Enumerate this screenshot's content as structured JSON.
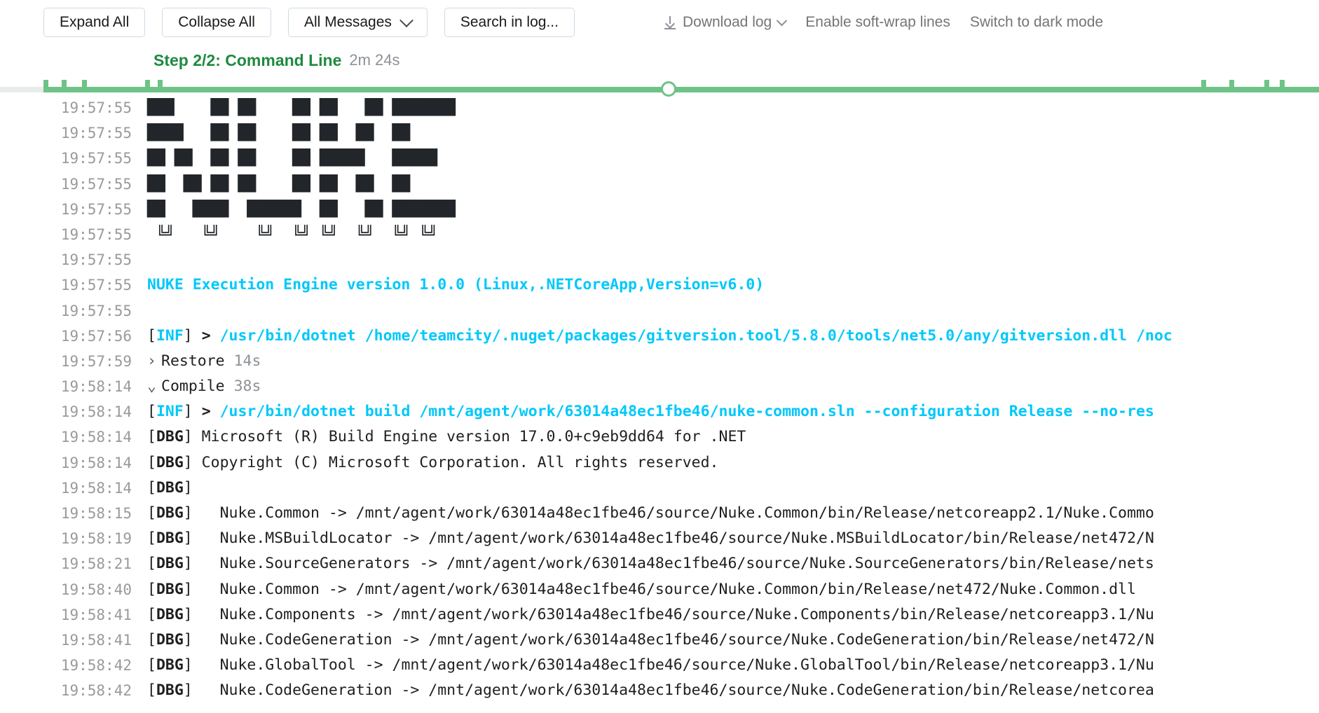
{
  "toolbar": {
    "expand_all": "Expand All",
    "collapse_all": "Collapse All",
    "filter_label": "All Messages",
    "search_label": "Search in log...",
    "download_log": "Download log",
    "soft_wrap": "Enable soft-wrap lines",
    "dark_mode": "Switch to dark mode",
    "download_icon": "download-icon",
    "chevron_icon": "chevron-down-icon"
  },
  "step": {
    "title": "Step 2/2: Command Line",
    "duration": "2m 24s",
    "progress_percent": 49,
    "accent_color": "#1f8a3f",
    "bar_color": "#6ec387",
    "track_color": "#e8eaec"
  },
  "log": {
    "lines": [
      {
        "ts": "19:57:55",
        "type": "art",
        "text": "███    ██ ██    ██ ██   ██ ███████"
      },
      {
        "ts": "19:57:55",
        "type": "art",
        "text": "████   ██ ██    ██ ██  ██  ██"
      },
      {
        "ts": "19:57:55",
        "type": "art",
        "text": "██ ██  ██ ██    ██ █████   █████"
      },
      {
        "ts": "19:57:55",
        "type": "art",
        "text": "██  ██ ██ ██    ██ ██  ██  ██"
      },
      {
        "ts": "19:57:55",
        "type": "art",
        "text": "██   ████  ██████  ██   ██ ███████"
      },
      {
        "ts": "19:57:55",
        "type": "art",
        "text": " ╚╝   ╚╝    ╚╝  ╚╝ ╚╝  ╚╝  ╚╝ ╚╝"
      },
      {
        "ts": "19:57:55",
        "type": "blank",
        "text": ""
      },
      {
        "ts": "19:57:55",
        "type": "cyan",
        "text": "NUKE Execution Engine version 1.0.0 (Linux,.NETCoreApp,Version=v6.0)"
      },
      {
        "ts": "19:57:55",
        "type": "blank",
        "text": ""
      },
      {
        "ts": "19:57:56",
        "type": "inf-cmd",
        "level": "INF",
        "arrow": ">",
        "text": "/usr/bin/dotnet /home/teamcity/.nuget/packages/gitversion.tool/5.8.0/tools/net5.0/any/gitversion.dll /noc"
      },
      {
        "ts": "19:57:59",
        "type": "block",
        "fold": "collapsed",
        "name": "Restore",
        "duration": "14s"
      },
      {
        "ts": "19:58:14",
        "type": "block",
        "fold": "expanded",
        "name": "Compile",
        "duration": "38s"
      },
      {
        "ts": "19:58:14",
        "type": "inf-cmd-indent",
        "level": "INF",
        "arrow": ">",
        "text": "/usr/bin/dotnet build /mnt/agent/work/63014a48ec1fbe46/nuke-common.sln --configuration Release --no-res"
      },
      {
        "ts": "19:58:14",
        "type": "dbg",
        "level": "DBG",
        "text": "Microsoft (R) Build Engine version 17.0.0+c9eb9dd64 for .NET"
      },
      {
        "ts": "19:58:14",
        "type": "dbg",
        "level": "DBG",
        "text": "Copyright (C) Microsoft Corporation. All rights reserved."
      },
      {
        "ts": "19:58:14",
        "type": "dbg",
        "level": "DBG",
        "text": ""
      },
      {
        "ts": "19:58:15",
        "type": "dbg",
        "level": "DBG",
        "text": "  Nuke.Common -> /mnt/agent/work/63014a48ec1fbe46/source/Nuke.Common/bin/Release/netcoreapp2.1/Nuke.Commo"
      },
      {
        "ts": "19:58:19",
        "type": "dbg",
        "level": "DBG",
        "text": "  Nuke.MSBuildLocator -> /mnt/agent/work/63014a48ec1fbe46/source/Nuke.MSBuildLocator/bin/Release/net472/N"
      },
      {
        "ts": "19:58:21",
        "type": "dbg",
        "level": "DBG",
        "text": "  Nuke.SourceGenerators -> /mnt/agent/work/63014a48ec1fbe46/source/Nuke.SourceGenerators/bin/Release/nets"
      },
      {
        "ts": "19:58:40",
        "type": "dbg",
        "level": "DBG",
        "text": "  Nuke.Common -> /mnt/agent/work/63014a48ec1fbe46/source/Nuke.Common/bin/Release/net472/Nuke.Common.dll"
      },
      {
        "ts": "19:58:41",
        "type": "dbg",
        "level": "DBG",
        "text": "  Nuke.Components -> /mnt/agent/work/63014a48ec1fbe46/source/Nuke.Components/bin/Release/netcoreapp3.1/Nu"
      },
      {
        "ts": "19:58:41",
        "type": "dbg",
        "level": "DBG",
        "text": "  Nuke.CodeGeneration -> /mnt/agent/work/63014a48ec1fbe46/source/Nuke.CodeGeneration/bin/Release/net472/N"
      },
      {
        "ts": "19:58:42",
        "type": "dbg",
        "level": "DBG",
        "text": "  Nuke.GlobalTool -> /mnt/agent/work/63014a48ec1fbe46/source/Nuke.GlobalTool/bin/Release/netcoreapp3.1/Nu"
      },
      {
        "ts": "19:58:42",
        "type": "dbg",
        "level": "DBG",
        "text": "  Nuke.CodeGeneration -> /mnt/agent/work/63014a48ec1fbe46/source/Nuke.CodeGeneration/bin/Release/netcorea"
      }
    ]
  }
}
